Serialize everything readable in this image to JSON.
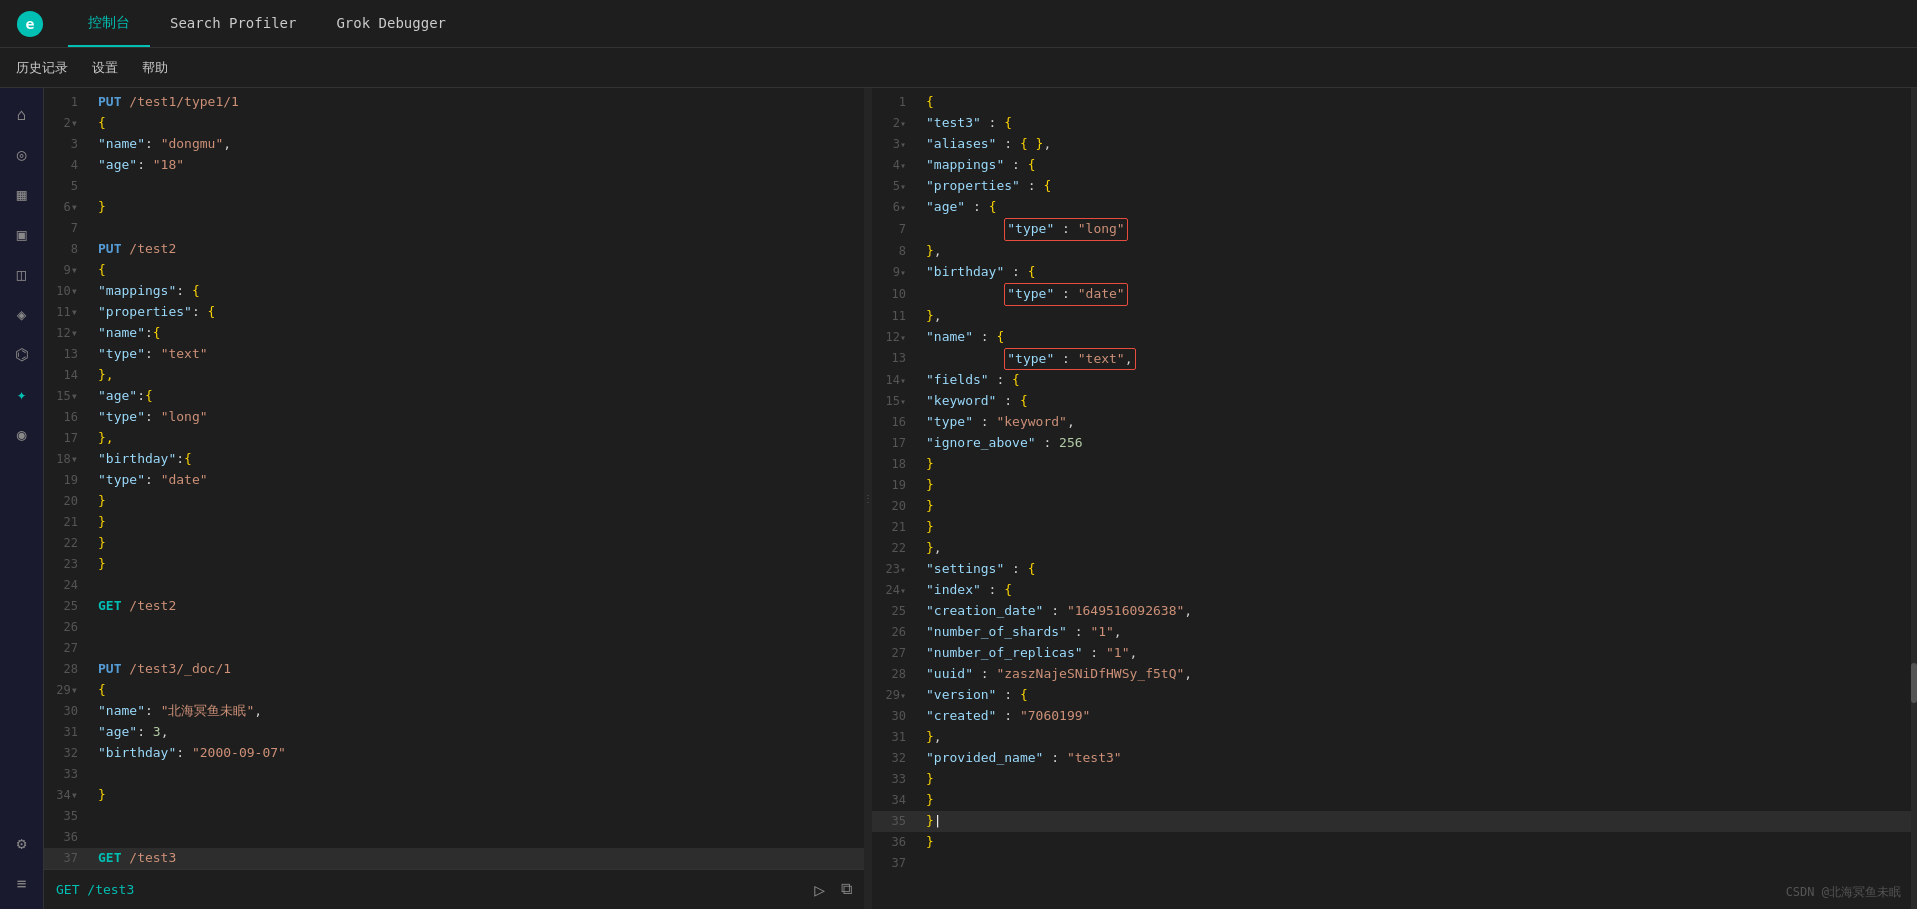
{
  "topNav": {
    "tabs": [
      {
        "id": "console",
        "label": "控制台",
        "active": true
      },
      {
        "id": "search-profiler",
        "label": "Search Profiler",
        "active": false
      },
      {
        "id": "grok-debugger",
        "label": "Grok Debugger",
        "active": false
      }
    ]
  },
  "secondNav": {
    "items": [
      {
        "id": "history",
        "label": "历史记录"
      },
      {
        "id": "settings",
        "label": "设置"
      },
      {
        "id": "help",
        "label": "帮助"
      }
    ]
  },
  "sidebar": {
    "icons": [
      {
        "id": "home",
        "symbol": "⌂",
        "active": false
      },
      {
        "id": "discover",
        "symbol": "◎",
        "active": false
      },
      {
        "id": "dashboard",
        "symbol": "▦",
        "active": false
      },
      {
        "id": "visualize",
        "symbol": "▣",
        "active": false
      },
      {
        "id": "canvas",
        "symbol": "◫",
        "active": false
      },
      {
        "id": "maps",
        "symbol": "◈",
        "active": false
      },
      {
        "id": "ml",
        "symbol": "⌬",
        "active": false
      },
      {
        "id": "devtools",
        "symbol": "✦",
        "active": true
      },
      {
        "id": "stack",
        "symbol": "◉",
        "active": false
      },
      {
        "id": "settings2",
        "symbol": "⚙",
        "active": false
      }
    ]
  },
  "leftPane": {
    "lines": [
      {
        "num": 1,
        "text": "PUT /test1/type1/1",
        "type": "method-path"
      },
      {
        "num": 2,
        "text": "{",
        "type": "brace",
        "fold": true
      },
      {
        "num": 3,
        "text": "  \"name\":\"dongmu\",",
        "type": "kv"
      },
      {
        "num": 4,
        "text": "  \"age\":\"18\"",
        "type": "kv"
      },
      {
        "num": 5,
        "text": "",
        "type": "empty"
      },
      {
        "num": 6,
        "text": "}",
        "type": "brace",
        "fold": true
      },
      {
        "num": 7,
        "text": "",
        "type": "empty"
      },
      {
        "num": 8,
        "text": "PUT /test2",
        "type": "method-path"
      },
      {
        "num": 9,
        "text": "{",
        "type": "brace",
        "fold": true
      },
      {
        "num": 10,
        "text": "  \"mappings\": {",
        "type": "kv-brace",
        "fold": true
      },
      {
        "num": 11,
        "text": "    \"properties\": {",
        "type": "kv-brace",
        "fold": true
      },
      {
        "num": 12,
        "text": "      \"name\":{",
        "type": "kv-brace",
        "fold": true
      },
      {
        "num": 13,
        "text": "        \"type\": \"text\"",
        "type": "kv"
      },
      {
        "num": 14,
        "text": "      },",
        "type": "brace"
      },
      {
        "num": 15,
        "text": "      \"age\":{",
        "type": "kv-brace",
        "fold": true
      },
      {
        "num": 16,
        "text": "        \"type\": \"long\"",
        "type": "kv"
      },
      {
        "num": 17,
        "text": "      },",
        "type": "brace"
      },
      {
        "num": 18,
        "text": "      \"birthday\":{",
        "type": "kv-brace",
        "fold": true
      },
      {
        "num": 19,
        "text": "        \"type\": \"date\"",
        "type": "kv"
      },
      {
        "num": 20,
        "text": "      }",
        "type": "brace"
      },
      {
        "num": 21,
        "text": "    }",
        "type": "brace"
      },
      {
        "num": 22,
        "text": "  }",
        "type": "brace"
      },
      {
        "num": 23,
        "text": "}",
        "type": "brace"
      },
      {
        "num": 24,
        "text": "",
        "type": "empty"
      },
      {
        "num": 25,
        "text": "GET /test2",
        "type": "method-path-get"
      },
      {
        "num": 26,
        "text": "",
        "type": "empty"
      },
      {
        "num": 27,
        "text": "",
        "type": "empty"
      },
      {
        "num": 28,
        "text": "PUT /test3/_doc/1",
        "type": "method-path"
      },
      {
        "num": 29,
        "text": "{",
        "type": "brace",
        "fold": true
      },
      {
        "num": 30,
        "text": "  \"name\":\"北海冥鱼未眠\",",
        "type": "kv"
      },
      {
        "num": 31,
        "text": "  \"age\":3,",
        "type": "kv"
      },
      {
        "num": 32,
        "text": "  \"birthday\":\"2000-09-07\"",
        "type": "kv"
      },
      {
        "num": 33,
        "text": "",
        "type": "empty"
      },
      {
        "num": 34,
        "text": "}",
        "type": "brace",
        "fold": true
      },
      {
        "num": 35,
        "text": "",
        "type": "empty"
      },
      {
        "num": 36,
        "text": "",
        "type": "empty"
      },
      {
        "num": 37,
        "text": "GET /test3",
        "type": "method-path-get-active"
      }
    ]
  },
  "rightPane": {
    "lines": [
      {
        "num": 1,
        "text": "{",
        "type": "brace"
      },
      {
        "num": 2,
        "text": "  \"test3\" : {",
        "type": "kv-brace",
        "fold": true
      },
      {
        "num": 3,
        "text": "    \"aliases\" : { },",
        "type": "kv-brace"
      },
      {
        "num": 4,
        "text": "    \"mappings\" : {",
        "type": "kv-brace",
        "fold": true
      },
      {
        "num": 5,
        "text": "      \"properties\" : {",
        "type": "kv-brace",
        "fold": true
      },
      {
        "num": 6,
        "text": "        \"age\" : {",
        "type": "kv-brace",
        "fold": true
      },
      {
        "num": 7,
        "text": "          \"type\" : \"long\"",
        "type": "kv",
        "redbox": true
      },
      {
        "num": 8,
        "text": "        },",
        "type": "brace"
      },
      {
        "num": 9,
        "text": "        \"birthday\" : {",
        "type": "kv-brace",
        "fold": true
      },
      {
        "num": 10,
        "text": "          \"type\" : \"date\"",
        "type": "kv",
        "redbox": true
      },
      {
        "num": 11,
        "text": "        },",
        "type": "brace"
      },
      {
        "num": 12,
        "text": "        \"name\" : {",
        "type": "kv-brace",
        "fold": true
      },
      {
        "num": 13,
        "text": "          \"type\" : \"text\",",
        "type": "kv",
        "redbox": true
      },
      {
        "num": 14,
        "text": "          \"fields\" : {",
        "type": "kv-brace",
        "fold": true
      },
      {
        "num": 15,
        "text": "            \"keyword\" : {",
        "type": "kv-brace",
        "fold": true
      },
      {
        "num": 16,
        "text": "              \"type\" : \"keyword\",",
        "type": "kv"
      },
      {
        "num": 17,
        "text": "              \"ignore_above\" : 256",
        "type": "kv"
      },
      {
        "num": 18,
        "text": "            }",
        "type": "brace"
      },
      {
        "num": 19,
        "text": "          }",
        "type": "brace"
      },
      {
        "num": 20,
        "text": "        }",
        "type": "brace"
      },
      {
        "num": 21,
        "text": "      }",
        "type": "brace"
      },
      {
        "num": 22,
        "text": "    },",
        "type": "brace"
      },
      {
        "num": 23,
        "text": "    \"settings\" : {",
        "type": "kv-brace",
        "fold": true
      },
      {
        "num": 24,
        "text": "      \"index\" : {",
        "type": "kv-brace",
        "fold": true
      },
      {
        "num": 25,
        "text": "        \"creation_date\" : \"1649516092638\",",
        "type": "kv"
      },
      {
        "num": 26,
        "text": "        \"number_of_shards\" : \"1\",",
        "type": "kv"
      },
      {
        "num": 27,
        "text": "        \"number_of_replicas\" : \"1\",",
        "type": "kv"
      },
      {
        "num": 28,
        "text": "        \"uuid\" : \"zaszNajeSNiDfHWSy_f5tQ\",",
        "type": "kv"
      },
      {
        "num": 29,
        "text": "        \"version\" : {",
        "type": "kv-brace",
        "fold": true
      },
      {
        "num": 30,
        "text": "          \"created\" : \"7060199\"",
        "type": "kv"
      },
      {
        "num": 31,
        "text": "        },",
        "type": "brace"
      },
      {
        "num": 32,
        "text": "        \"provided_name\" : \"test3\"",
        "type": "kv"
      },
      {
        "num": 33,
        "text": "      }",
        "type": "brace"
      },
      {
        "num": 34,
        "text": "    }",
        "type": "brace"
      },
      {
        "num": 35,
        "text": "  }",
        "type": "brace-cursor"
      },
      {
        "num": 36,
        "text": "}",
        "type": "brace"
      },
      {
        "num": 37,
        "text": "",
        "type": "empty"
      }
    ]
  },
  "bottomBar": {
    "runLabel": "▷",
    "copyLabel": "⧉",
    "watermark": "CSDN @北海冥鱼未眠"
  }
}
